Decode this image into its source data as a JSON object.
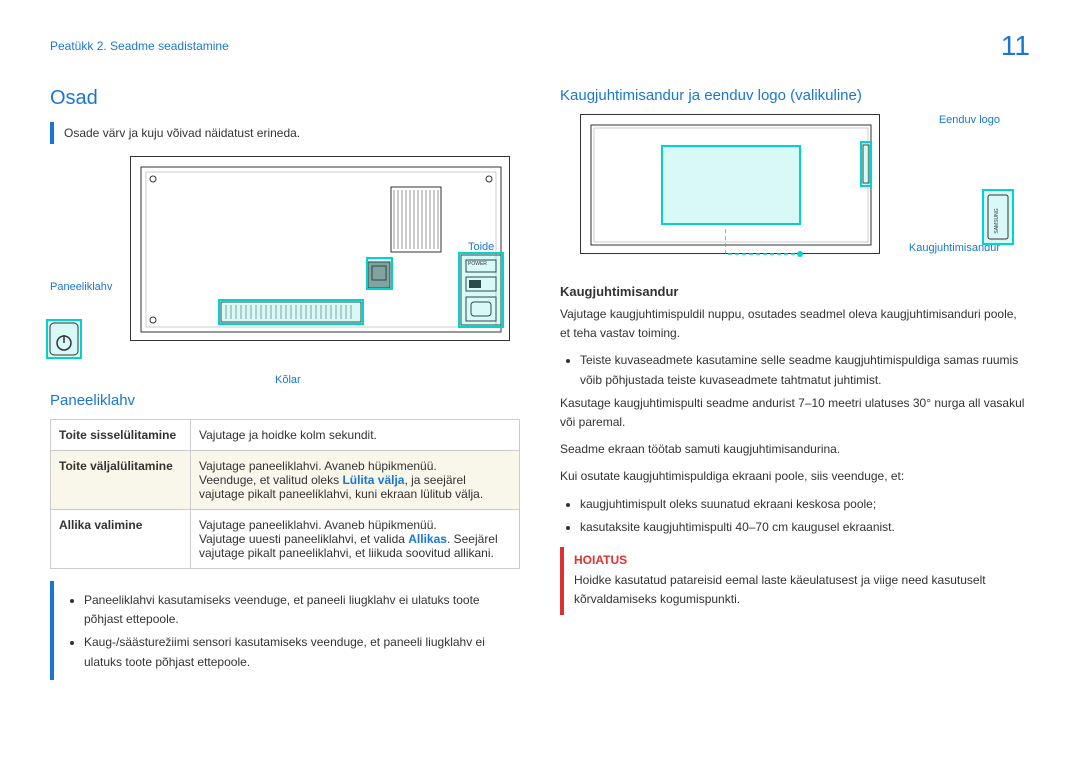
{
  "header": {
    "chapter": "Peatükk 2. Seadme seadistamine",
    "page": "11"
  },
  "left": {
    "title": "Osad",
    "note": "Osade värv ja kuju võivad näidatust erineda.",
    "labels": {
      "paneeliklahv": "Paneeliklahv",
      "toide": "Toide",
      "kolar": "Kõlar"
    },
    "sub1": "Paneeliklahv",
    "table": {
      "r1c1": "Toite sisselülitamine",
      "r1c2": "Vajutage ja hoidke kolm sekundit.",
      "r2c1": "Toite väljalülitamine",
      "r2c2a": "Vajutage paneeliklahvi. Avaneb hüpikmenüü.",
      "r2c2b1": "Veenduge, et valitud oleks ",
      "r2c2link": "Lülita välja",
      "r2c2b2": ", ja seejärel vajutage pikalt paneeliklahvi, kuni ekraan lülitub välja.",
      "r3c1": "Allika valimine",
      "r3c2a": "Vajutage paneeliklahvi. Avaneb hüpikmenüü.",
      "r3c2b1": "Vajutage uuesti paneeliklahvi, et valida ",
      "r3c2link": "Allikas",
      "r3c2b2": ". Seejärel vajutage pikalt paneeliklahvi, et liikuda soovitud allikani."
    },
    "notes": {
      "n1": "Paneeliklahvi kasutamiseks veenduge, et paneeli liugklahv ei ulatuks toote põhjast ettepoole.",
      "n2": "Kaug-/säästurežiimi sensori kasutamiseks veenduge, et paneeli liugklahv ei ulatuks toote põhjast ettepoole."
    }
  },
  "right": {
    "title": "Kaugjuhtimisandur ja eenduv logo (valikuline)",
    "labels": {
      "eenduv": "Eenduv logo",
      "kaug": "Kaugjuhtimisandur"
    },
    "sub1": "Kaugjuhtimisandur",
    "p1": "Vajutage kaugjuhtimispuldil nuppu, osutades seadmel oleva kaugjuhtimisanduri poole, et teha vastav toiming.",
    "b1": "Teiste kuvaseadmete kasutamine selle seadme kaugjuhtimispuldiga samas ruumis võib põhjustada teiste kuvaseadmete tahtmatut juhtimist.",
    "p2": "Kasutage kaugjuhtimispulti seadme andurist 7–10 meetri ulatuses 30° nurga all vasakul või paremal.",
    "p3": "Seadme ekraan töötab samuti kaugjuhtimisandurina.",
    "p4": "Kui osutate kaugjuhtimispuldiga ekraani poole, siis veenduge, et:",
    "b2": "kaugjuhtimispult oleks suunatud ekraani keskosa poole;",
    "b3": "kasutaksite kaugjuhtimispulti 40–70 cm kaugusel ekraanist.",
    "warn_title": "HOIATUS",
    "warn_body": "Hoidke kasutatud patareisid eemal laste käeulatusest ja viige need kasutuselt kõrvaldamiseks kogumispunkti."
  },
  "power_label": "POWER"
}
